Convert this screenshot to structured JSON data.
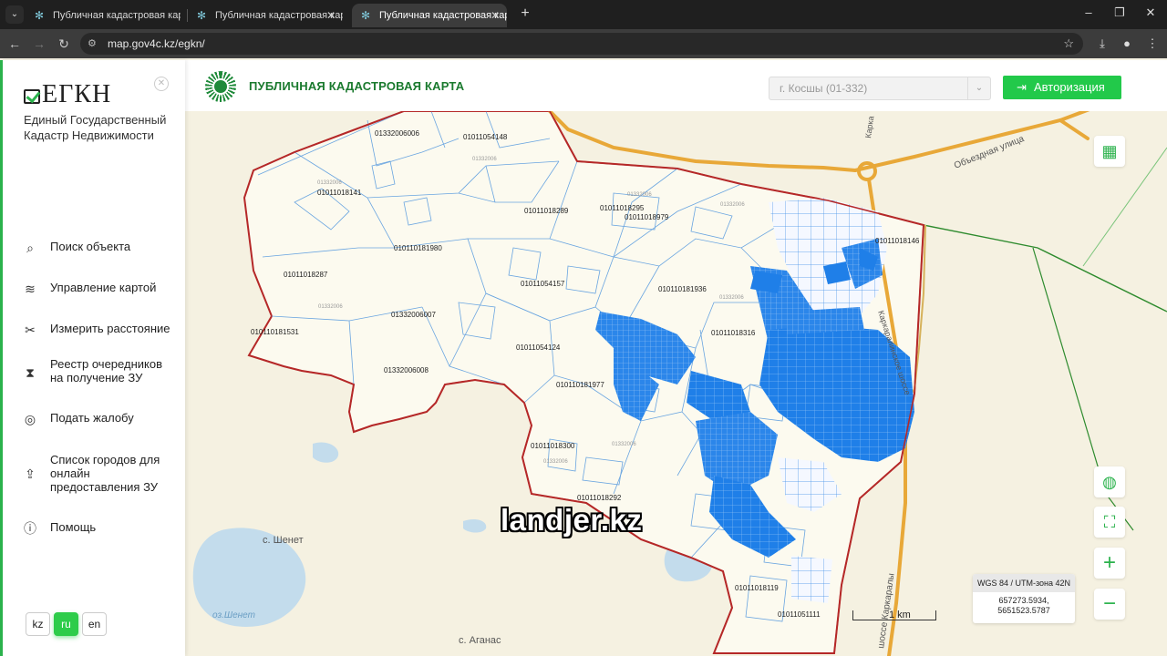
{
  "browser": {
    "tabs": [
      {
        "title": "Публичная кадастровая карта"
      },
      {
        "title": "Публичная кадастровая карта"
      },
      {
        "title": "Публичная кадастровая карта"
      }
    ],
    "url": "map.gov4c.kz/egkn/"
  },
  "sidebar": {
    "logo": "ЕГКН",
    "subtitle": "Единый Государственный Кадастр Недвижимости",
    "menu": [
      {
        "label": "Поиск объекта",
        "icon": "search-icon"
      },
      {
        "label": "Управление картой",
        "icon": "layers-icon"
      },
      {
        "label": "Измерить расстояние",
        "icon": "ruler-icon"
      },
      {
        "label": "Реестр очередников на получение ЗУ",
        "icon": "hourglass-icon"
      },
      {
        "label": "Подать жалобу",
        "icon": "complaint-icon"
      },
      {
        "label": "Список городов для онлайн предоставления ЗУ",
        "icon": "upload-doc-icon"
      },
      {
        "label": "Помощь",
        "icon": "help-icon"
      }
    ],
    "languages": [
      "kz",
      "ru",
      "en"
    ],
    "active_language": "ru"
  },
  "header": {
    "title": "ПУБЛИЧНАЯ КАДАСТРОВАЯ КАРТА",
    "region_value": "г. Косшы (01-332)",
    "login_label": "Авторизация"
  },
  "map": {
    "parcel_labels": [
      "01332006006",
      "01011054148",
      "01011018141",
      "01011018289",
      "01011018295",
      "01011018979",
      "01011018146",
      "010110181980",
      "01011018287",
      "01011054157",
      "010110181936",
      "01332006007",
      "010110181531",
      "01011054124",
      "01011018316",
      "01332006008",
      "010110181977",
      "01011018300",
      "01011018292",
      "01011018119",
      "01011051111"
    ],
    "grey_labels": [
      "01332006",
      "01332006",
      "01332006",
      "01332006",
      "01332006",
      "01332006",
      "01332006",
      "01332006"
    ],
    "place_labels": [
      "с. Шенет",
      "оз.Шенет",
      "с. Аганас"
    ],
    "road_labels": [
      "Объездная улица",
      "Карка",
      "Каркаралинское шоссе",
      "шоссе Каркаралы"
    ],
    "coord_system": "WGS 84 / UTM-зона 42N",
    "coord_x": "657273.5934,",
    "coord_y": "5651523.5787",
    "scale_label": "1 km",
    "watermark": "landjer.kz"
  },
  "colors": {
    "accent": "#22c94a",
    "brand_green": "#1a7a2e",
    "parcel_blue": "#1f7fe8",
    "boundary_red": "#b02020",
    "road_orange": "#e8a838"
  }
}
